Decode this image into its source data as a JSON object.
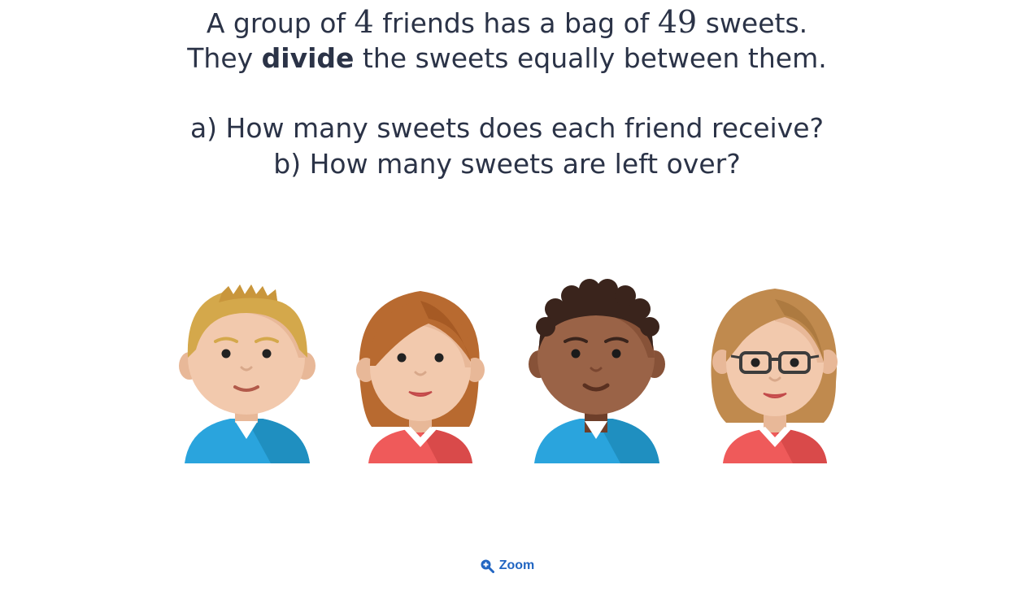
{
  "question": {
    "line1": {
      "pre": "A group of ",
      "n1": "4",
      "mid": " friends has a bag of ",
      "n2": "49",
      "post": " sweets."
    },
    "line2": {
      "pre": "They ",
      "bold": "divide",
      "post": " the sweets equally between them."
    },
    "part_a": "a) How many sweets does each friend receive?",
    "part_b": "b) How many sweets are left over?"
  },
  "illustration": {
    "friends": [
      {
        "name": "boy-blond",
        "skin": "#f2c9ad",
        "hair": "#d4a84b",
        "shirt": "#2aa4dd"
      },
      {
        "name": "girl-auburn",
        "skin": "#f2c9ad",
        "hair": "#b86a30",
        "shirt": "#ef5a5a"
      },
      {
        "name": "boy-dark",
        "skin": "#9a6347",
        "hair": "#3a241c",
        "shirt": "#2aa4dd"
      },
      {
        "name": "girl-glasses",
        "skin": "#f2c9ad",
        "hair": "#c08a4e",
        "shirt": "#ef5a5a"
      }
    ]
  },
  "zoom": {
    "label": "Zoom",
    "icon": "zoom-in-icon"
  }
}
